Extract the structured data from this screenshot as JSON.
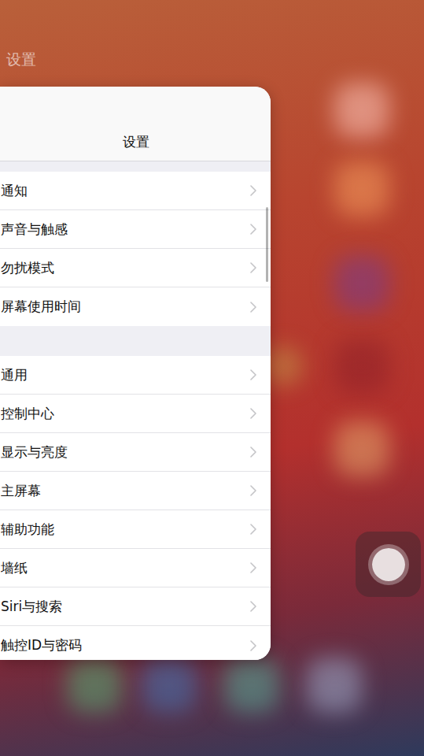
{
  "app_label": "设置",
  "card": {
    "title": "设置",
    "groups": [
      {
        "rows": [
          {
            "label": "通知"
          },
          {
            "label": "声音与触感"
          },
          {
            "label": "勿扰模式"
          },
          {
            "label": "屏幕使用时间"
          }
        ]
      },
      {
        "rows": [
          {
            "label": "通用"
          },
          {
            "label": "控制中心"
          },
          {
            "label": "显示与亮度"
          },
          {
            "label": "主屏幕"
          },
          {
            "label": "辅助功能"
          },
          {
            "label": "墙纸"
          },
          {
            "label": "Siri与搜索"
          },
          {
            "label": "触控ID与密码"
          }
        ]
      }
    ],
    "scrollbar": {
      "start": 0.21,
      "size": 0.13
    }
  }
}
